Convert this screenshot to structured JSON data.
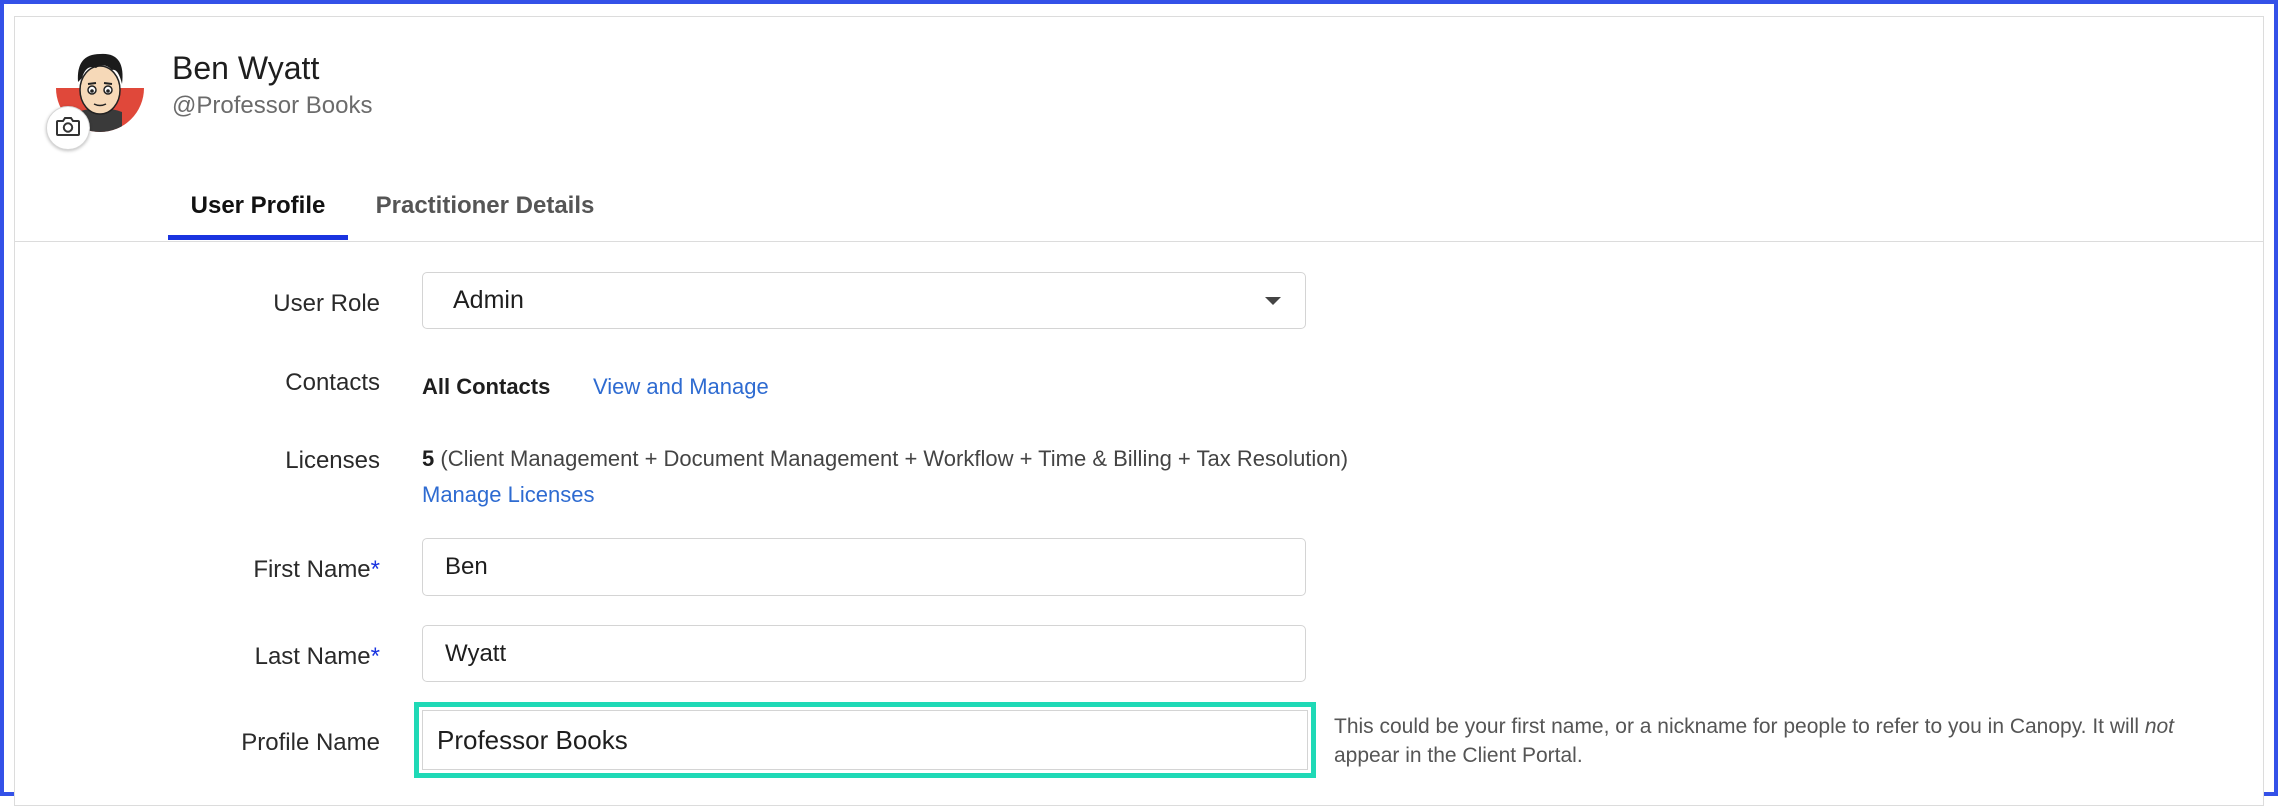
{
  "header": {
    "name": "Ben Wyatt",
    "handle": "@Professor Books"
  },
  "tabs": [
    {
      "label": "User Profile",
      "active": true
    },
    {
      "label": "Practitioner Details",
      "active": false
    }
  ],
  "form": {
    "user_role": {
      "label": "User Role",
      "value": "Admin"
    },
    "contacts": {
      "label": "Contacts",
      "value": "All Contacts",
      "link": "View and Manage"
    },
    "licenses": {
      "label": "Licenses",
      "count": "5",
      "detail": "(Client Management + Document Management + Workflow + Time & Billing + Tax Resolution)",
      "link": "Manage Licenses"
    },
    "first_name": {
      "label": "First Name",
      "required_mark": "*",
      "value": "Ben"
    },
    "last_name": {
      "label": "Last Name",
      "required_mark": "*",
      "value": "Wyatt"
    },
    "profile_name": {
      "label": "Profile Name",
      "value": "Professor Books",
      "help_part1": "This could be your first name, or a nickname for people to refer to you in Canopy. It will ",
      "help_emphasis": "not",
      "help_part2": " appear in the Client Portal."
    }
  },
  "colors": {
    "accent": "#1a34e0",
    "link": "#2e6bd1",
    "highlight": "#1fd9b6",
    "frame": "#3451e8"
  }
}
